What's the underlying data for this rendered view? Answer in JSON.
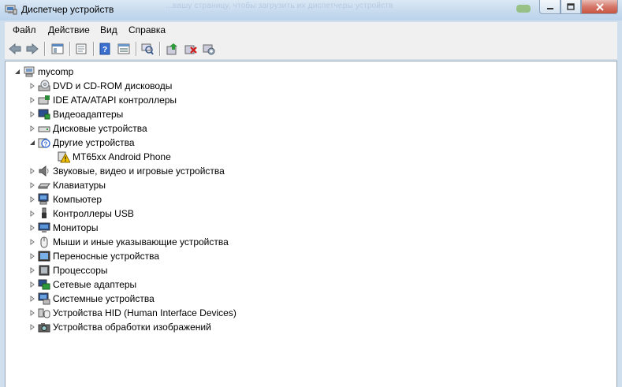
{
  "window": {
    "title": "Диспетчер устройств"
  },
  "background_blur_text": "...вашу страницу, чтобы загрузить их диспетчеры устройств",
  "menu": [
    "Файл",
    "Действие",
    "Вид",
    "Справка"
  ],
  "toolbar_icons": [
    "back-icon",
    "forward-icon",
    "console-tree-icon",
    "properties-icon",
    "help-icon",
    "view-icon",
    "scan-hardware-icon",
    "update-driver-icon",
    "uninstall-icon",
    "disable-icon"
  ],
  "tree": {
    "root": "mycomp",
    "items": [
      {
        "label": "DVD и CD-ROM дисководы",
        "icon": "dvd-drive-icon",
        "level": 1,
        "expanded": false
      },
      {
        "label": "IDE ATA/ATAPI контроллеры",
        "icon": "ide-controller-icon",
        "level": 1,
        "expanded": false
      },
      {
        "label": "Видеоадаптеры",
        "icon": "display-adapter-icon",
        "level": 1,
        "expanded": false
      },
      {
        "label": "Дисковые устройства",
        "icon": "disk-drive-icon",
        "level": 1,
        "expanded": false
      },
      {
        "label": "Другие устройства",
        "icon": "other-devices-icon",
        "level": 1,
        "expanded": true
      },
      {
        "label": "MT65xx Android Phone",
        "icon": "warning-device-icon",
        "level": 2,
        "expanded": null
      },
      {
        "label": "Звуковые, видео и игровые устройства",
        "icon": "sound-icon",
        "level": 1,
        "expanded": false
      },
      {
        "label": "Клавиатуры",
        "icon": "keyboard-icon",
        "level": 1,
        "expanded": false
      },
      {
        "label": "Компьютер",
        "icon": "computer-icon",
        "level": 1,
        "expanded": false
      },
      {
        "label": "Контроллеры USB",
        "icon": "usb-icon",
        "level": 1,
        "expanded": false
      },
      {
        "label": "Мониторы",
        "icon": "monitor-icon",
        "level": 1,
        "expanded": false
      },
      {
        "label": "Мыши и иные указывающие устройства",
        "icon": "mouse-icon",
        "level": 1,
        "expanded": false
      },
      {
        "label": "Переносные устройства",
        "icon": "portable-device-icon",
        "level": 1,
        "expanded": false
      },
      {
        "label": "Процессоры",
        "icon": "processor-icon",
        "level": 1,
        "expanded": false
      },
      {
        "label": "Сетевые адаптеры",
        "icon": "network-adapter-icon",
        "level": 1,
        "expanded": false
      },
      {
        "label": "Системные устройства",
        "icon": "system-device-icon",
        "level": 1,
        "expanded": false
      },
      {
        "label": "Устройства HID (Human Interface Devices)",
        "icon": "hid-icon",
        "level": 1,
        "expanded": false
      },
      {
        "label": "Устройства обработки изображений",
        "icon": "imaging-device-icon",
        "level": 1,
        "expanded": false
      }
    ]
  },
  "colors": {
    "titlebar": "#c6daee",
    "close_button": "#c8553f",
    "warning": "#f2c200"
  }
}
